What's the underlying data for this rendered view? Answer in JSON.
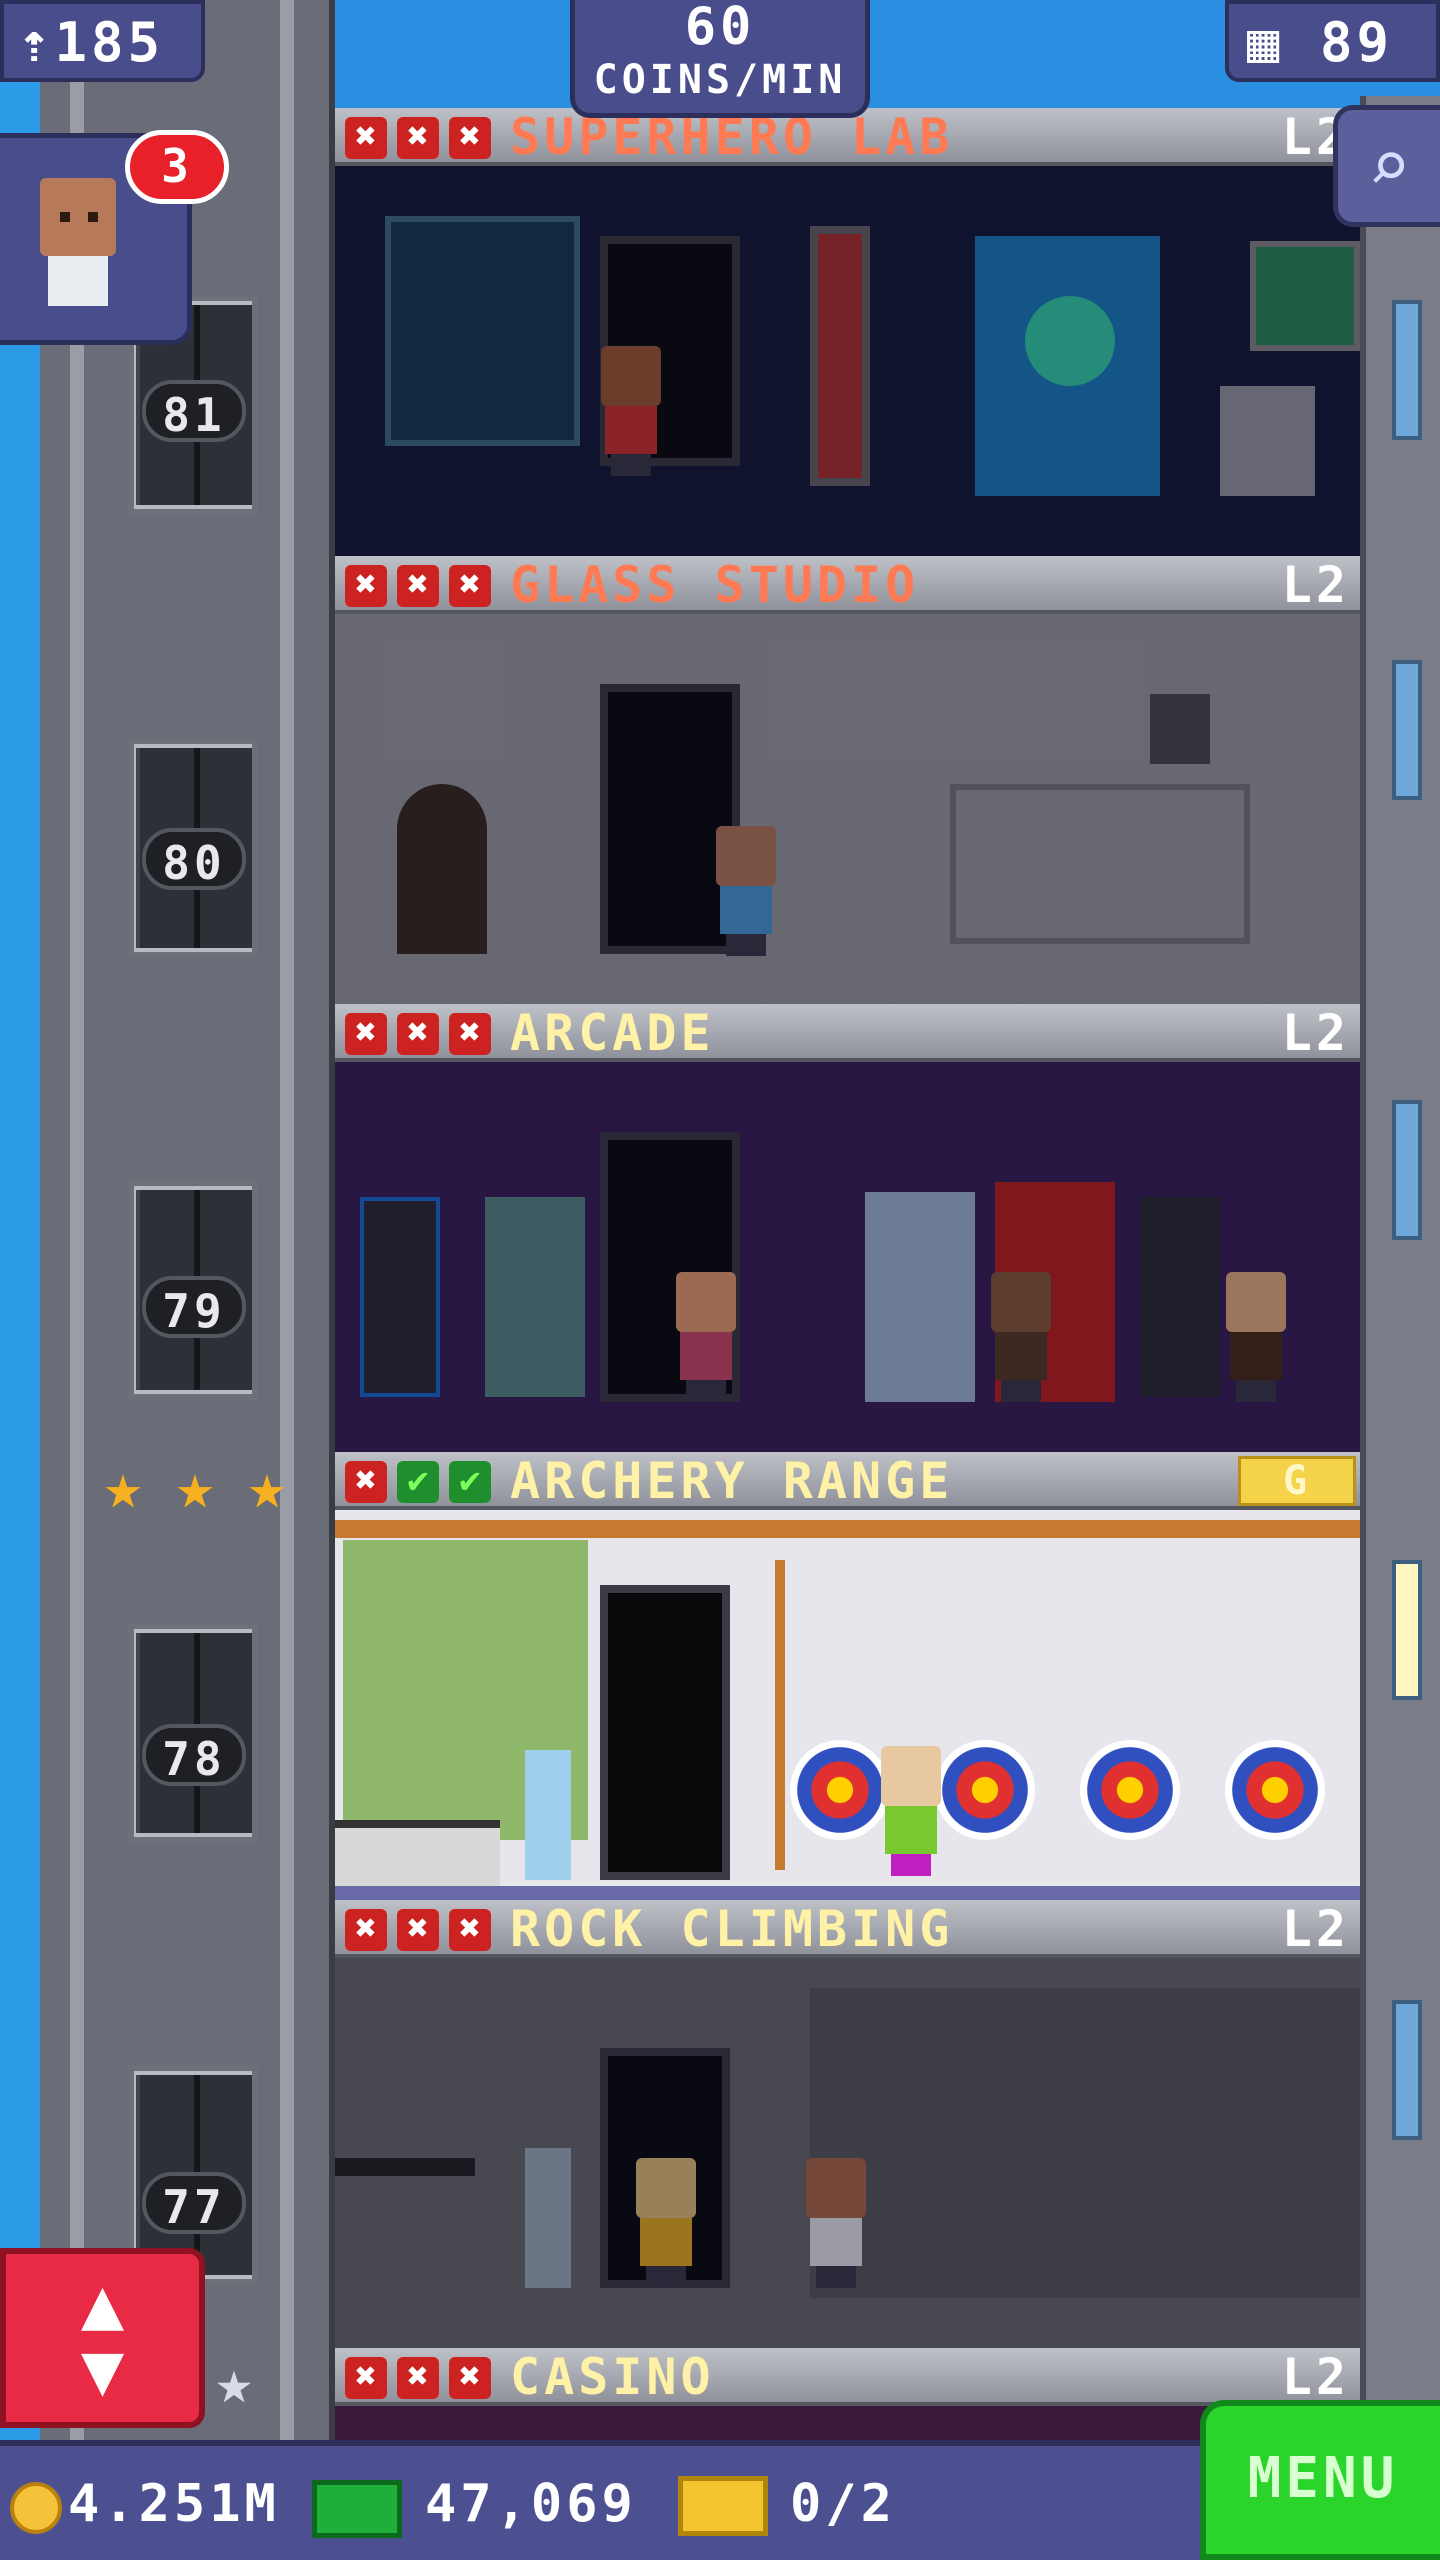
{
  "hud": {
    "population": "185",
    "population_icon": "person-up-icon",
    "coins_rate_value": "60",
    "coins_rate_label": "COINS/MIN",
    "floors": "89",
    "floors_icon": "building-icon",
    "search_icon": "magnifier-icon",
    "visitor_count": "3"
  },
  "elevator": {
    "floor_numbers": [
      "81",
      "80",
      "79",
      "78",
      "77"
    ],
    "button_label": "▲\n▼"
  },
  "floors": [
    {
      "name": "SUPERHERO LAB",
      "name_shown": "SUPERHERO LAB",
      "level": "L2",
      "stock": [
        "x",
        "x",
        "x"
      ],
      "name_color": "#ff7a52"
    },
    {
      "name": "GLASS STUDIO",
      "level": "L2",
      "stock": [
        "x",
        "x",
        "x"
      ],
      "name_color": "#ff7a52"
    },
    {
      "name": "ARCADE",
      "level": "L2",
      "stock": [
        "x",
        "x",
        "x"
      ],
      "name_color": "#fff2a6"
    },
    {
      "name": "ARCHERY RANGE",
      "level": "G",
      "stock": [
        "x",
        "ok",
        "ok"
      ],
      "name_color": "#fff2a6"
    },
    {
      "name": "ROCK CLIMBING",
      "level": "L2",
      "stock": [
        "x",
        "x",
        "x"
      ],
      "name_color": "#fff2a6"
    },
    {
      "name": "CASINO",
      "level": "L2",
      "stock": [
        "x",
        "x",
        "x"
      ],
      "name_color": "#fff2a6"
    }
  ],
  "stars": {
    "gold": 3,
    "silver": 1
  },
  "bottom": {
    "coins": "4.251M",
    "bux": "47,069",
    "tickets": "0/2",
    "menu_label": "MENU"
  },
  "colors": {
    "accent": "#4a4d8c",
    "menu": "#2bd42b",
    "elevator_button": "#e82a44"
  }
}
